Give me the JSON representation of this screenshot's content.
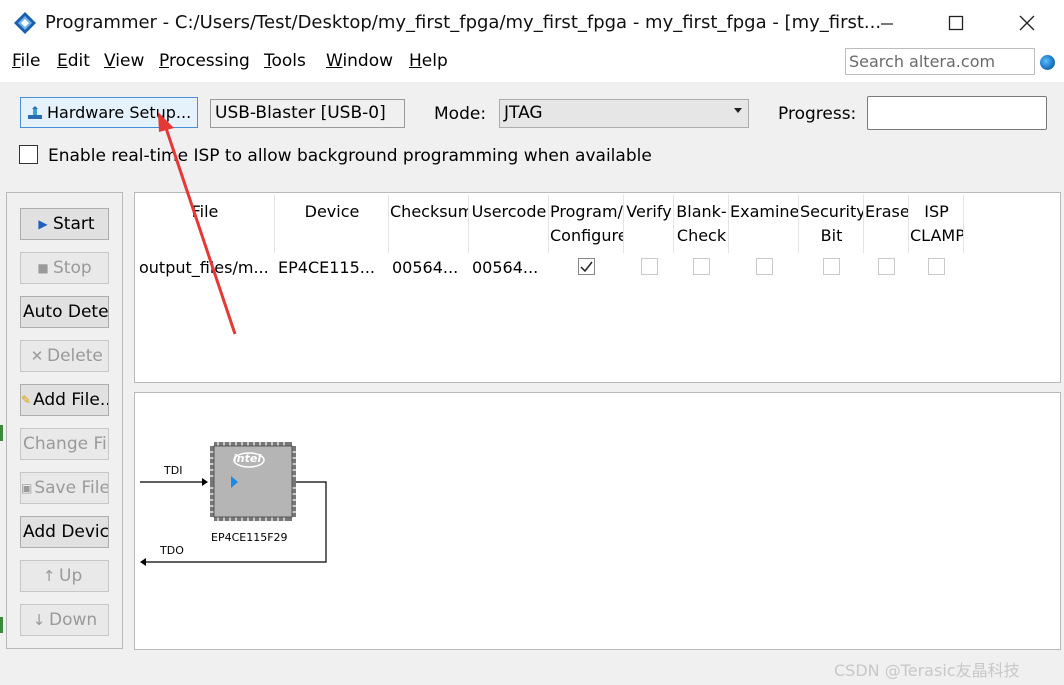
{
  "window": {
    "title": "Programmer - C:/Users/Test/Desktop/my_first_fpga/my_first_fpga - my_first_fpga - [my_first...",
    "minimize_icon": "minimize-icon",
    "maximize_icon": "maximize-icon",
    "close_icon": "close-icon"
  },
  "menu": {
    "items": [
      {
        "label": "File",
        "accel": "F",
        "rest": "ile"
      },
      {
        "label": "Edit",
        "accel": "E",
        "rest": "dit"
      },
      {
        "label": "View",
        "accel": "V",
        "rest": "iew"
      },
      {
        "label": "Processing",
        "accel": "P",
        "rest": "rocessing"
      },
      {
        "label": "Tools",
        "accel": "T",
        "rest": "ools"
      },
      {
        "label": "Window",
        "accel": "W",
        "rest": "indow"
      },
      {
        "label": "Help",
        "accel": "H",
        "rest": "elp"
      }
    ],
    "search_placeholder": "Search altera.com"
  },
  "toolbar": {
    "hardware_setup_label": "Hardware Setup...",
    "hardware_value": "USB-Blaster [USB-0]",
    "mode_label": "Mode:",
    "mode_value": "JTAG",
    "progress_label": "Progress:",
    "isp_label": "Enable real-time ISP to allow background programming when available",
    "isp_checked": false
  },
  "side_buttons": [
    {
      "label": "Start",
      "enabled": true
    },
    {
      "label": "Stop",
      "enabled": false
    },
    {
      "label": "Auto Detect",
      "enabled": true
    },
    {
      "label": "Delete",
      "enabled": false
    },
    {
      "label": "Add File...",
      "enabled": true
    },
    {
      "label": "Change File...",
      "enabled": false
    },
    {
      "label": "Save File",
      "enabled": false
    },
    {
      "label": "Add Device...",
      "enabled": true
    },
    {
      "label": "Up",
      "enabled": false
    },
    {
      "label": "Down",
      "enabled": false
    }
  ],
  "table": {
    "columns": [
      {
        "line1": "File",
        "line2": ""
      },
      {
        "line1": "Device",
        "line2": ""
      },
      {
        "line1": "Checksum",
        "line2": ""
      },
      {
        "line1": "Usercode",
        "line2": ""
      },
      {
        "line1": "Program/",
        "line2": "Configure"
      },
      {
        "line1": "Verify",
        "line2": ""
      },
      {
        "line1": "Blank-",
        "line2": "Check"
      },
      {
        "line1": "Examine",
        "line2": ""
      },
      {
        "line1": "Security",
        "line2": "Bit"
      },
      {
        "line1": "Erase",
        "line2": ""
      },
      {
        "line1": "ISP",
        "line2": "CLAMP"
      }
    ],
    "rows": [
      {
        "file": "output_files/m...",
        "device": "EP4CE115...",
        "checksum": "00564...",
        "usercode": "00564...",
        "program": true,
        "verify": false,
        "blank_check": false,
        "examine": false,
        "security": false,
        "erase": false,
        "isp_clamp": false
      }
    ]
  },
  "chain": {
    "tdi_label": "TDI",
    "tdo_label": "TDO",
    "chip_brand": "intel",
    "device_name": "EP4CE115F29"
  },
  "watermark": "CSDN @Terasic友晶科技",
  "colors": {
    "accent": "#4a90d9",
    "annotation_arrow": "#e53935"
  }
}
